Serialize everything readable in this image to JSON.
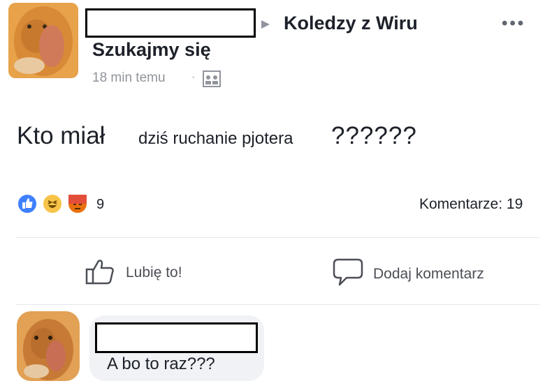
{
  "post": {
    "author_name_redacted": "",
    "group_name": "Koledzy z Wiru",
    "title": "Szukajmy się",
    "timestamp": "18 min temu",
    "separator": "·",
    "more_label": "•••",
    "body_part1": "Kto miał",
    "body_part2": "dziś ruchanie pjotera",
    "body_part3": "??????",
    "reactions": {
      "icons": [
        "like-icon",
        "haha-icon",
        "angry-icon"
      ],
      "count": "9"
    },
    "comments_label": "Komentarze: 19"
  },
  "actions": {
    "like_label": "Lubię to!",
    "comment_label": "Dodaj komentarz"
  },
  "comment": {
    "author_name_redacted": "",
    "text": "A bo to raz???"
  },
  "colors": {
    "like_blue": "#4080ff",
    "haha_yellow": "#f7c44a",
    "angry_red": "#e9710f",
    "meta_gray": "#90949c"
  }
}
